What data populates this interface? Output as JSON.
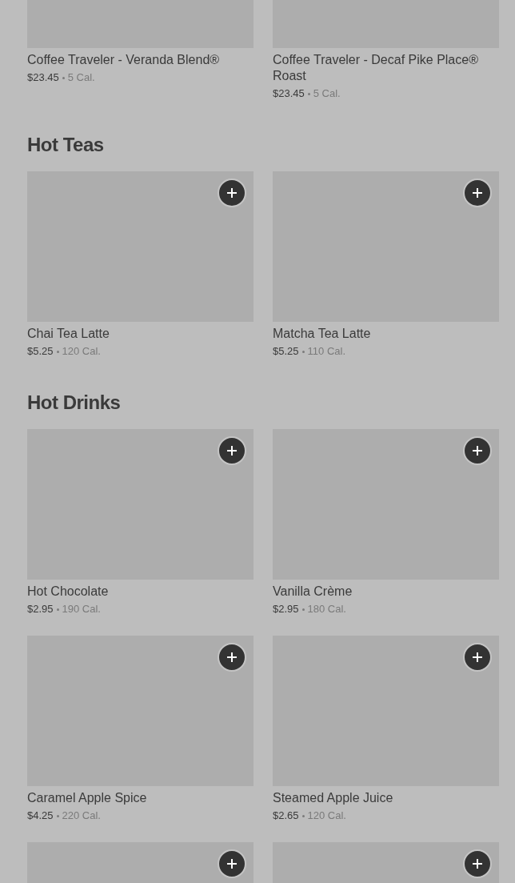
{
  "sections": [
    {
      "items": [
        {
          "name": "Coffee Traveler - Veranda Blend®",
          "price": "$23.45",
          "calories": "5 Cal."
        },
        {
          "name": "Coffee Traveler - Decaf Pike Place® Roast",
          "price": "$23.45",
          "calories": "5 Cal."
        }
      ]
    },
    {
      "title": "Hot Teas",
      "items": [
        {
          "name": "Chai Tea Latte",
          "price": "$5.25",
          "calories": "120 Cal."
        },
        {
          "name": "Matcha Tea Latte",
          "price": "$5.25",
          "calories": "110 Cal."
        }
      ]
    },
    {
      "title": "Hot Drinks",
      "items": [
        {
          "name": "Hot Chocolate",
          "price": "$2.95",
          "calories": "190 Cal."
        },
        {
          "name": "Vanilla Crème",
          "price": "$2.95",
          "calories": "180 Cal."
        },
        {
          "name": "Caramel Apple Spice",
          "price": "$4.25",
          "calories": "220 Cal."
        },
        {
          "name": "Steamed Apple Juice",
          "price": "$2.65",
          "calories": "120 Cal."
        }
      ]
    }
  ]
}
